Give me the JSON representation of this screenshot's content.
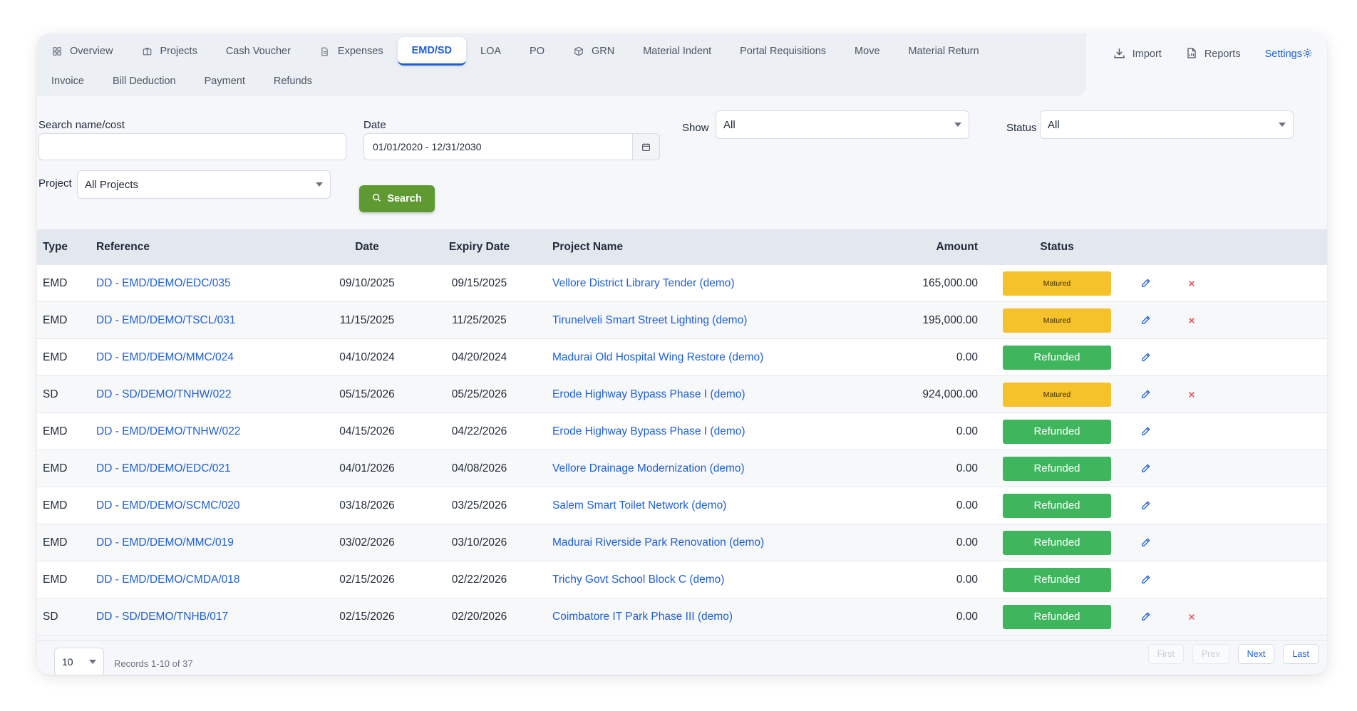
{
  "tabs_row1": [
    {
      "label": "Overview",
      "icon": "grid-icon"
    },
    {
      "label": "Projects",
      "icon": "briefcase-icon"
    },
    {
      "label": "Cash Voucher",
      "icon": ""
    },
    {
      "label": "Expenses",
      "icon": "document-icon"
    },
    {
      "label": "EMD/SD",
      "icon": "",
      "active": true
    },
    {
      "label": "LOA",
      "icon": ""
    },
    {
      "label": "PO",
      "icon": ""
    },
    {
      "label": "GRN",
      "icon": "box-icon"
    },
    {
      "label": "Material Indent",
      "icon": ""
    },
    {
      "label": "Portal Requisitions",
      "icon": ""
    },
    {
      "label": "Move",
      "icon": ""
    },
    {
      "label": "Material Return",
      "icon": ""
    }
  ],
  "tabs_row2": [
    {
      "label": "Invoice"
    },
    {
      "label": "Bill Deduction"
    },
    {
      "label": "Payment"
    },
    {
      "label": "Refunds"
    }
  ],
  "actions": {
    "import": "Import",
    "reports": "Reports",
    "settings": "Settings"
  },
  "filters": {
    "search_label": "Search name/cost",
    "search_value": "",
    "date_label": "Date",
    "date_value": "01/01/2020 - 12/31/2030",
    "show_label": "Show",
    "show_value": "All",
    "status_label": "Status",
    "status_value": "All",
    "project_label": "Project",
    "project_value": "All Projects",
    "search_button": "Search"
  },
  "table": {
    "headers": {
      "type": "Type",
      "reference": "Reference",
      "date": "Date",
      "expiry": "Expiry Date",
      "project": "Project Name",
      "amount": "Amount",
      "status": "Status"
    },
    "rows": [
      {
        "type": "EMD",
        "reference": "DD - EMD/DEMO/EDC/035",
        "date": "09/10/2025",
        "expiry": "09/15/2025",
        "project": "Vellore District Library Tender (demo)",
        "amount": "165,000.00",
        "status": "Matured",
        "deletable": true
      },
      {
        "type": "EMD",
        "reference": "DD - EMD/DEMO/TSCL/031",
        "date": "11/15/2025",
        "expiry": "11/25/2025",
        "project": "Tirunelveli Smart Street Lighting (demo)",
        "amount": "195,000.00",
        "status": "Matured",
        "deletable": true
      },
      {
        "type": "EMD",
        "reference": "DD - EMD/DEMO/MMC/024",
        "date": "04/10/2024",
        "expiry": "04/20/2024",
        "project": "Madurai Old Hospital Wing Restore (demo)",
        "amount": "0.00",
        "status": "Refunded",
        "deletable": false
      },
      {
        "type": "SD",
        "reference": "DD - SD/DEMO/TNHW/022",
        "date": "05/15/2026",
        "expiry": "05/25/2026",
        "project": "Erode Highway Bypass Phase I (demo)",
        "amount": "924,000.00",
        "status": "Matured",
        "deletable": true
      },
      {
        "type": "EMD",
        "reference": "DD - EMD/DEMO/TNHW/022",
        "date": "04/15/2026",
        "expiry": "04/22/2026",
        "project": "Erode Highway Bypass Phase I (demo)",
        "amount": "0.00",
        "status": "Refunded",
        "deletable": false
      },
      {
        "type": "EMD",
        "reference": "DD - EMD/DEMO/EDC/021",
        "date": "04/01/2026",
        "expiry": "04/08/2026",
        "project": "Vellore Drainage Modernization (demo)",
        "amount": "0.00",
        "status": "Refunded",
        "deletable": false
      },
      {
        "type": "EMD",
        "reference": "DD - EMD/DEMO/SCMC/020",
        "date": "03/18/2026",
        "expiry": "03/25/2026",
        "project": "Salem Smart Toilet Network (demo)",
        "amount": "0.00",
        "status": "Refunded",
        "deletable": false
      },
      {
        "type": "EMD",
        "reference": "DD - EMD/DEMO/MMC/019",
        "date": "03/02/2026",
        "expiry": "03/10/2026",
        "project": "Madurai Riverside Park Renovation (demo)",
        "amount": "0.00",
        "status": "Refunded",
        "deletable": false
      },
      {
        "type": "EMD",
        "reference": "DD - EMD/DEMO/CMDA/018",
        "date": "02/15/2026",
        "expiry": "02/22/2026",
        "project": "Trichy Govt School Block C (demo)",
        "amount": "0.00",
        "status": "Refunded",
        "deletable": false
      },
      {
        "type": "SD",
        "reference": "DD - SD/DEMO/TNHB/017",
        "date": "02/15/2026",
        "expiry": "02/20/2026",
        "project": "Coimbatore IT Park Phase III (demo)",
        "amount": "0.00",
        "status": "Refunded",
        "deletable": true
      }
    ]
  },
  "footer": {
    "page_size": "10",
    "records": "Records 1-10 of 37",
    "first": "First",
    "prev": "Prev",
    "next": "Next",
    "last": "Last"
  },
  "colors": {
    "accent": "#1d5fd6",
    "matured": "#f6c22b",
    "refunded": "#3fb65e",
    "search_button": "#5e9a31",
    "delete": "#e5484d"
  }
}
